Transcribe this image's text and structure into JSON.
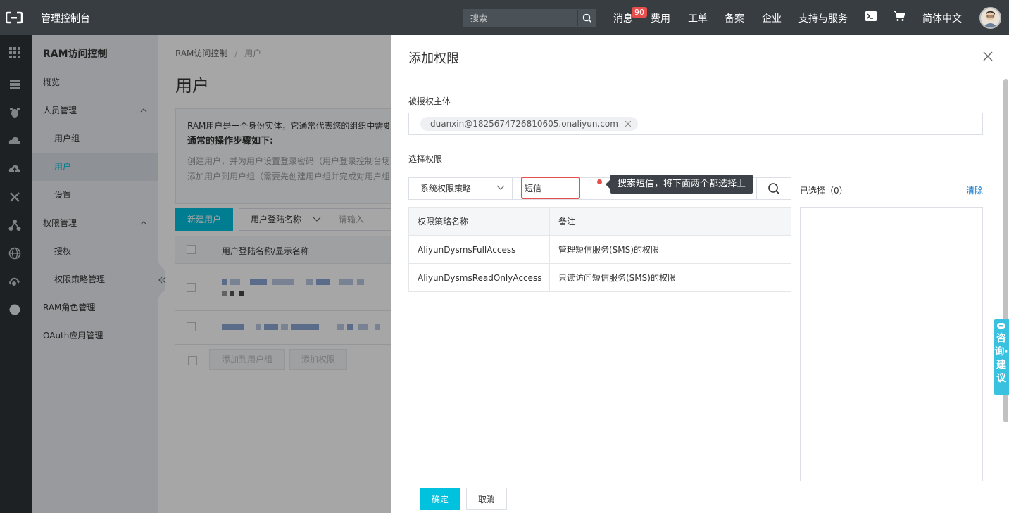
{
  "topbar": {
    "title": "管理控制台",
    "search_placeholder": "搜索",
    "nav": [
      "消息",
      "费用",
      "工单",
      "备案",
      "企业",
      "支持与服务",
      "简体中文"
    ],
    "badge": "90"
  },
  "sidebar": {
    "title": "RAM访问控制",
    "items": [
      "概览",
      "人员管理",
      "用户组",
      "用户",
      "设置",
      "权限管理",
      "授权",
      "权限策略管理",
      "RAM角色管理",
      "OAuth应用管理"
    ]
  },
  "main": {
    "breadcrumb_root": "RAM访问控制",
    "breadcrumb_sep": "/",
    "breadcrumb_current": "用户",
    "page_title": "用户",
    "info_line1": "RAM用户是一个身份实体，它通常代表您的组织中需要",
    "info_line2": "通常的操作步骤如下:",
    "info_line3": "创建用户，并为用户设置登录密码（用户登录控制台场",
    "info_line4": "添加用户到用户组（需要先创建用户组并完成对用户组",
    "new_user": "新建用户",
    "filter_select": "用户登陆名称",
    "filter_placeholder": "请输入",
    "col_header": "用户登陆名称/显示名称",
    "add_to_group": "添加到用户组",
    "add_permission": "添加权限"
  },
  "drawer": {
    "title": "添加权限",
    "principal_label": "被授权主体",
    "principal_tag": "duanxin@1825674726810605.onaliyun.com",
    "select_label": "选择权限",
    "policy_type": "系统权限策略",
    "search_value": "短信",
    "tooltip": "搜索短信，将下面两个都选择上",
    "table": {
      "headers": [
        "权限策略名称",
        "备注"
      ],
      "rows": [
        [
          "AliyunDysmsFullAccess",
          "管理短信服务(SMS)的权限"
        ],
        [
          "AliyunDysmsReadOnlyAccess",
          "只读访问短信服务(SMS)的权限"
        ]
      ]
    },
    "selected_label": "已选择（0）",
    "clear": "清除",
    "ok": "确定",
    "cancel": "取消"
  },
  "consult": "咨询·建议",
  "colors": {
    "accent": "#00c1de",
    "topbar": "#373d41",
    "danger": "#e84e4b",
    "link": "#0070cc"
  }
}
